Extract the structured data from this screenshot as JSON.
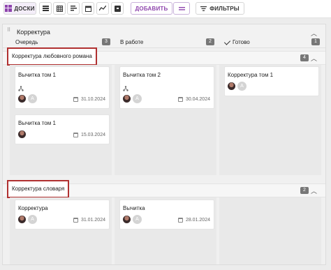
{
  "toolbar": {
    "boards_label": "ДОСКИ",
    "add_label": "ДОБАВИТЬ",
    "filters_label": "ФИЛЬТРЫ"
  },
  "board": {
    "title": "Корректура",
    "columns": [
      {
        "label": "Очередь",
        "count": "3"
      },
      {
        "label": "В работе",
        "count": "2"
      },
      {
        "label": "Готово",
        "count": "1"
      }
    ],
    "groups": [
      {
        "label": "Корректура любовного романа",
        "count": "4",
        "cards": {
          "queue": [
            {
              "title": "Вычитка том 1",
              "date": "31.10.2024",
              "avatar_letter": "A"
            },
            {
              "title": "Вычитка том 1",
              "date": "15.03.2024",
              "avatar_letter": ""
            }
          ],
          "in_progress": [
            {
              "title": "Вычитка том 2",
              "date": "30.04.2024",
              "avatar_letter": "A"
            }
          ],
          "done": [
            {
              "title": "Корректура том 1",
              "date": "",
              "avatar_letter": "A"
            }
          ]
        }
      },
      {
        "label": "Корректура словаря",
        "count": "2",
        "cards": {
          "queue": [
            {
              "title": "Корректура",
              "date": "31.01.2024",
              "avatar_letter": "A"
            }
          ],
          "in_progress": [
            {
              "title": "Вычитка",
              "date": "28.01.2024",
              "avatar_letter": "A"
            }
          ]
        }
      }
    ]
  },
  "colors": {
    "accent": "#8e44ad",
    "highlight": "#b03030",
    "badge": "#777777"
  }
}
